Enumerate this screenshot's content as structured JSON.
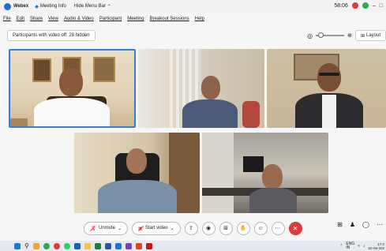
{
  "titlebar": {
    "app_name": "Webex",
    "meeting_info": "Meeting Info",
    "hide_menu": "Hide Menu Bar",
    "time": "58:06"
  },
  "menu": [
    "File",
    "Edit",
    "Share",
    "View",
    "Audio & Video",
    "Participant",
    "Meeting",
    "Breakout Sessions",
    "Help"
  ],
  "participants_bar": "Participants with video off: 28 hidden",
  "layout_label": "Layout",
  "controls": {
    "unmute": "Unmute",
    "start_video": "Start video"
  },
  "tray": {
    "lang_top": "ENG",
    "lang_bottom": "IN",
    "time": "17:0",
    "date": "02-08-202"
  },
  "colors": {
    "accent": "#3a7bd5",
    "end_call": "#e0383e",
    "record": "#e0383e"
  }
}
